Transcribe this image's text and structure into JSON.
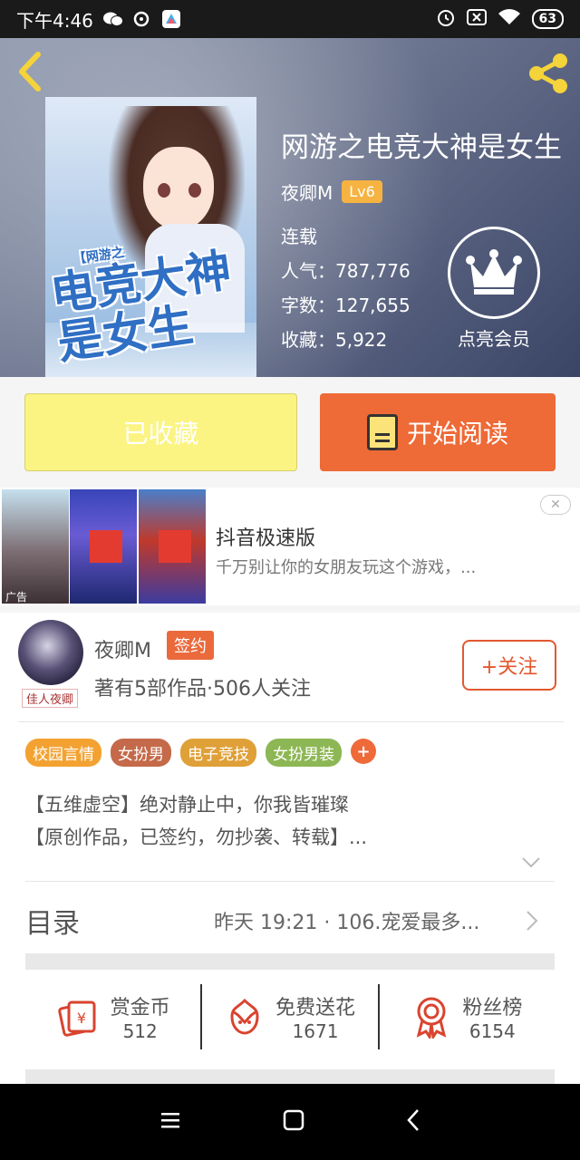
{
  "status_bar": {
    "time": "下午4:46",
    "battery": "63"
  },
  "book": {
    "title": "网游之电竞大神是女生",
    "author": "夜卿M",
    "level": "Lv6",
    "status": "连载",
    "popularity": "人气：787,776",
    "word_count": "字数：127,655",
    "favorites": "收藏：5,922",
    "cover_art_small": "【网游之",
    "cover_art_title": "电竞大神是女生"
  },
  "membership": {
    "label": "点亮会员"
  },
  "actions": {
    "collected_label": "已收藏",
    "read_label": "开始阅读"
  },
  "ad": {
    "tag": "广告",
    "title": "抖音极速版",
    "description": "千万别让你的女朋友玩这个游戏，..."
  },
  "author_section": {
    "name": "夜卿M",
    "signed_label": "签约",
    "meta": "著有5部作品·506人关注",
    "follow_label": "+关注",
    "avatar_tag": "佳人夜卿",
    "tags": [
      {
        "label": "校园言情",
        "color": "#f3a232"
      },
      {
        "label": "女扮男",
        "color": "#c46a4a"
      },
      {
        "label": "电子竞技",
        "color": "#e0a038"
      },
      {
        "label": "女扮男装",
        "color": "#8db755"
      }
    ],
    "tag_more": "+",
    "description_lines": [
      "【五维虚空】绝对静止中，你我皆璀璨",
      "【原创作品，已签约，勿抄袭、转载】..."
    ]
  },
  "toc": {
    "label": "目录",
    "latest": "昨天 19:21 · 106.宠爱最多..."
  },
  "rewards": [
    {
      "title": "赏金币",
      "count": "512",
      "icon": "red-envelope-icon"
    },
    {
      "title": "免费送花",
      "count": "1671",
      "icon": "flower-icon"
    },
    {
      "title": "粉丝榜",
      "count": "6154",
      "icon": "medal-icon"
    }
  ],
  "colors": {
    "accent": "#ee6a36",
    "collected": "#fbf482",
    "icon_red": "#d9442f"
  }
}
